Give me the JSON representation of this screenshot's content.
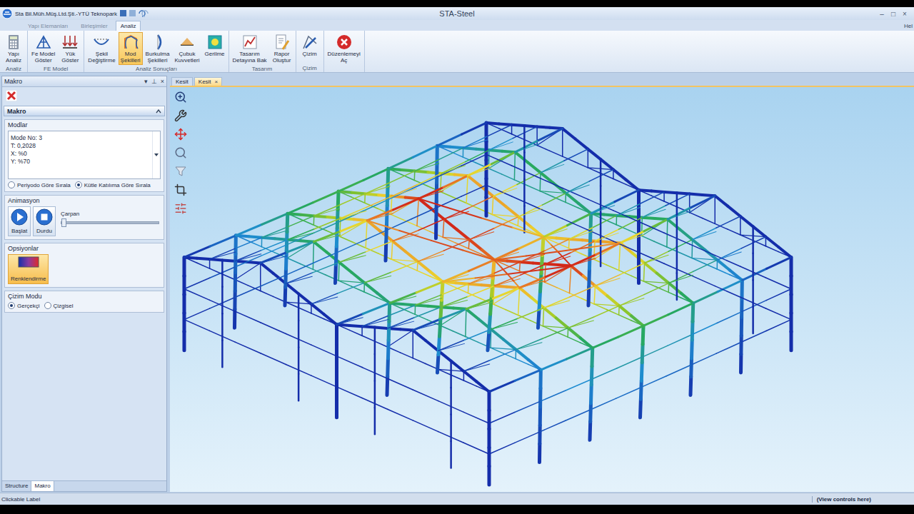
{
  "window": {
    "company": "Sta Bil.Müh.Müş.Ltd.Şti.-YTÜ Teknopark",
    "title": "STA-Steel",
    "controls": [
      "–",
      "□",
      "×"
    ],
    "help": "Hel"
  },
  "ribbon_tabs": [
    {
      "label": "Yapı Elemanları",
      "selected": false
    },
    {
      "label": "Birleşimler",
      "selected": false
    },
    {
      "label": "Analiz",
      "selected": true
    }
  ],
  "ribbon_groups": [
    {
      "label": "Analiz",
      "buttons": [
        {
          "lines": [
            "Yapı",
            "Analiz"
          ],
          "kind": "calc",
          "selected": false
        }
      ]
    },
    {
      "label": "FE Model",
      "buttons": [
        {
          "lines": [
            "Fe Model",
            "Göster"
          ],
          "kind": "fe",
          "selected": false
        },
        {
          "lines": [
            "Yük",
            "Göster"
          ],
          "kind": "load",
          "selected": false
        }
      ]
    },
    {
      "label": "Analiz Sonuçları",
      "buttons": [
        {
          "lines": [
            "Şekil",
            "Değiştirme"
          ],
          "kind": "deform",
          "selected": false
        },
        {
          "lines": [
            "Mod",
            "Şekilleri"
          ],
          "kind": "mode",
          "selected": true
        },
        {
          "lines": [
            "Burkulma",
            "Şekilleri"
          ],
          "kind": "buckle",
          "selected": false
        },
        {
          "lines": [
            "Çubuk",
            "Kuvvetleri"
          ],
          "kind": "force",
          "selected": false
        },
        {
          "lines": [
            "Gerilme"
          ],
          "kind": "stress",
          "selected": false
        }
      ]
    },
    {
      "label": "Tasarım",
      "buttons": [
        {
          "lines": [
            "Tasarım",
            "Detayına Bak"
          ],
          "kind": "design",
          "selected": false
        },
        {
          "lines": [
            "Rapor",
            "Oluştur"
          ],
          "kind": "report",
          "selected": false
        }
      ]
    },
    {
      "label": "Çizim",
      "buttons": [
        {
          "lines": [
            "Çizim"
          ],
          "kind": "draw",
          "selected": false
        }
      ]
    },
    {
      "label": "",
      "buttons": [
        {
          "lines": [
            "Düzenlemeyi",
            "Aç"
          ],
          "kind": "unlock",
          "selected": false
        }
      ]
    }
  ],
  "panel": {
    "title": "Makro",
    "header_glyphs": [
      "▾",
      "⊥",
      "×"
    ],
    "section": "Makro",
    "modes_label": "Modlar",
    "mode_lines": [
      "Mode No: 3",
      "T: 0,2028",
      "X: %0",
      "Y: %70"
    ],
    "sort_options": [
      {
        "label": "Periyodo Göre Sırala",
        "selected": false
      },
      {
        "label": "Kütle Katılıma Göre Sırala",
        "selected": true
      }
    ],
    "animation_label": "Animasyon",
    "animation_buttons": [
      {
        "label": "Başlat",
        "kind": "play"
      },
      {
        "label": "Durdu",
        "kind": "stop"
      }
    ],
    "multiplier": {
      "label": "Çarpan",
      "level": 0
    },
    "options_label": "Opsiyonlar",
    "options": [
      {
        "label": "Renklendirme",
        "selected": true
      }
    ],
    "draw_mode_label": "Çizim Modu",
    "draw_modes": [
      {
        "label": "Gerçekçi",
        "selected": true
      },
      {
        "label": "Çizgisel",
        "selected": false
      }
    ]
  },
  "bottom_tabs": [
    {
      "label": "Structure",
      "selected": false
    },
    {
      "label": "Makro",
      "selected": true
    }
  ],
  "doc_tabs": [
    {
      "label": "Kesit",
      "selected": false,
      "closable": false
    },
    {
      "label": "Kesit",
      "selected": true,
      "closable": true
    }
  ],
  "close_glyph": "×",
  "status_bar": {
    "left": "Clickable Label",
    "right": "(View controls here)"
  }
}
